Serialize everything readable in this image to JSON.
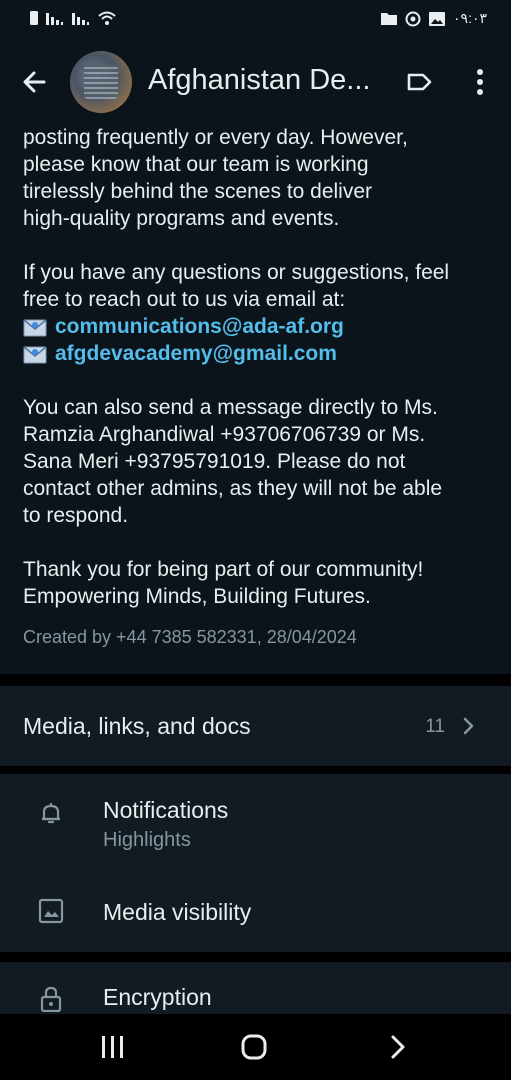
{
  "status_bar": {
    "time": "٠٩:٠٣",
    "icons": [
      "sim-icon",
      "signal-icon",
      "signal-icon",
      "wifi-icon",
      "folder-icon",
      "whatsapp-icon",
      "image-icon"
    ]
  },
  "header": {
    "title": "Afghanistan De...",
    "back_icon": "arrow-left-icon",
    "label_icon": "label-icon",
    "menu_icon": "more-vert-icon"
  },
  "description": {
    "para1": [
      "posting frequently or every day. However,",
      "please know that our team is working",
      "tirelessly behind the scenes to deliver",
      "high-quality programs and events."
    ],
    "para2": [
      "If you have any questions or suggestions, feel",
      "free to reach out to us via email at:"
    ],
    "emails": [
      "communications@ada-af.org",
      "afgdevacademy@gmail.com"
    ],
    "para3": [
      "You can also send a message directly to Ms.",
      "Ramzia Arghandiwal +93706706739 or Ms.",
      "Sana Meri +93795791019. Please do not",
      "contact other admins, as they will not be able",
      "to respond."
    ],
    "para4": [
      "Thank you for being part of our community!",
      "Empowering Minds, Building Futures."
    ]
  },
  "created_by": "Created by +44 7385 582331, 28/04/2024",
  "media": {
    "label": "Media, links, and docs",
    "count": "11"
  },
  "settings": {
    "notifications": {
      "label": "Notifications",
      "value": "Highlights"
    },
    "media_visibility": {
      "label": "Media visibility"
    },
    "encryption": {
      "label": "Encryption"
    }
  },
  "colors": {
    "background": "#0b141a",
    "section": "#111b21",
    "link": "#53bdeb",
    "secondary_text": "#8696a0",
    "primary_text": "#e9edef"
  }
}
